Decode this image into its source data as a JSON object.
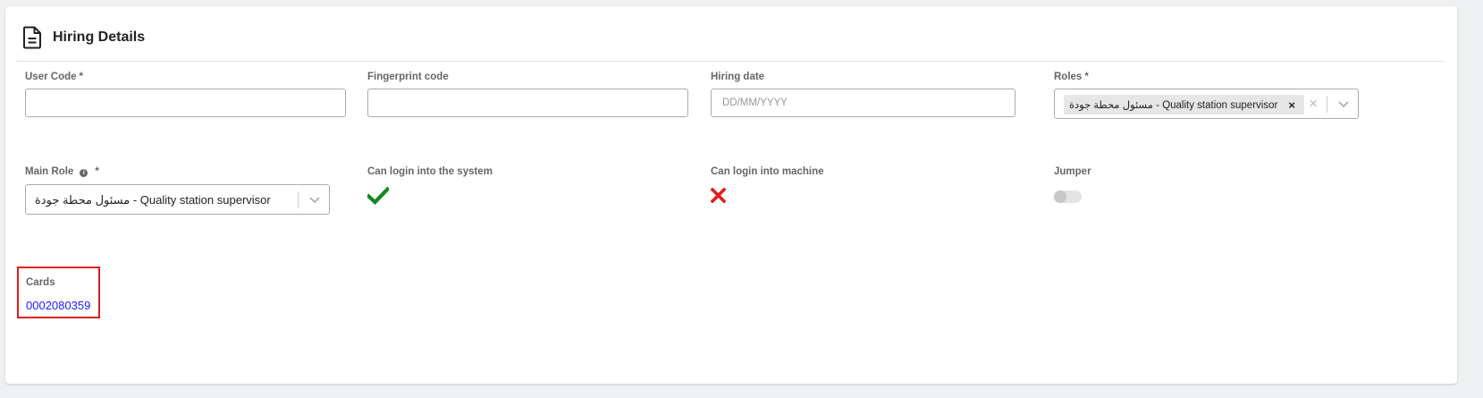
{
  "header": {
    "title": "Hiring Details",
    "icon": "document-icon"
  },
  "fields": {
    "user_code": {
      "label": "User Code",
      "required_mark": "*",
      "value": ""
    },
    "fingerprint_code": {
      "label": "Fingerprint code",
      "value": ""
    },
    "hiring_date": {
      "label": "Hiring date",
      "placeholder": "DD/MM/YYYY",
      "value": ""
    },
    "roles": {
      "label": "Roles",
      "required_mark": "*",
      "selected": [
        "مسئول محطة جودة - Quality station supervisor"
      ],
      "chip_remove": "×",
      "clear": "×"
    },
    "main_role": {
      "label": "Main Role",
      "info": "i",
      "required_mark": "*",
      "selected": "مسئول محطة جودة - Quality station supervisor"
    },
    "can_login_system": {
      "label": "Can login into the system",
      "value": true,
      "icon": "check-icon",
      "color": "#138a1f"
    },
    "can_login_machine": {
      "label": "Can login into machine",
      "value": false,
      "icon": "cross-icon",
      "color": "#e51b1b"
    },
    "jumper": {
      "label": "Jumper",
      "value": false
    }
  },
  "cards": {
    "label": "Cards",
    "values": [
      "0002080359"
    ],
    "highlight_color": "#e01b1b",
    "link_color": "#1a1aff"
  }
}
